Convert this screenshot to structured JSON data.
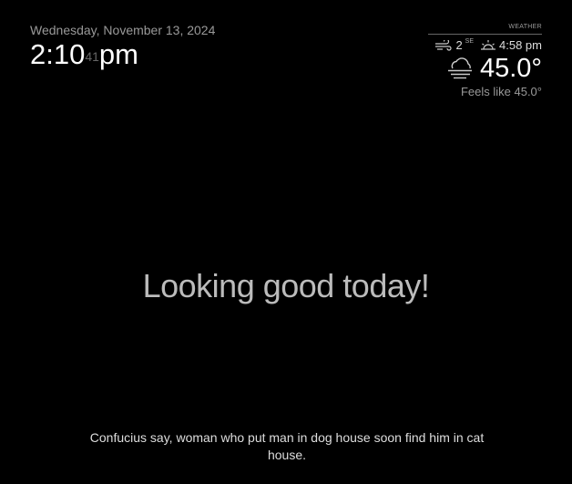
{
  "clock": {
    "date": "Wednesday, November 13, 2024",
    "time": "2:10",
    "seconds": "41",
    "period": "pm"
  },
  "weather": {
    "header": "WEATHER",
    "wind_speed": "2",
    "wind_direction": "SE",
    "sunset_time": "4:58 pm",
    "temperature": "45.0°",
    "feels_like": "Feels like 45.0°",
    "icons": {
      "wind": "wind-icon",
      "sunset": "sunset-icon",
      "condition": "cloudy-fog-icon"
    }
  },
  "compliment": {
    "text": "Looking good today!"
  },
  "quote": {
    "text": "Confucius say, woman who put man in dog house soon find him in cat house."
  },
  "colors": {
    "background": "#000000",
    "primary_text": "#ffffff",
    "secondary_text": "#999999",
    "compliment_text": "#bbbbbb"
  }
}
